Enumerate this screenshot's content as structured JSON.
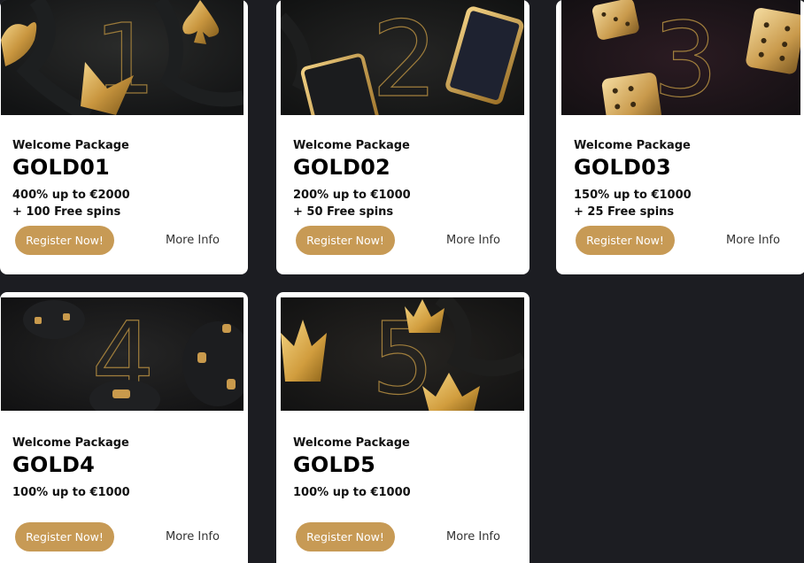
{
  "colors": {
    "page_bg": "#1c1d22",
    "card_bg": "#ffffff",
    "accent_gold": "#c79a55",
    "banner_bg": "#16171b"
  },
  "cards": [
    {
      "label": "Welcome Package",
      "code": "GOLD01",
      "bonus_line_1": "400% up to €2000",
      "bonus_line_2": "+ 100 Free spins",
      "register_label": "Register Now!",
      "more_info_label": "More Info",
      "banner_numeral": "1",
      "banner_icon": "gold-card-suits-icon"
    },
    {
      "label": "Welcome Package",
      "code": "GOLD02",
      "bonus_line_1": "200% up to €1000",
      "bonus_line_2": "+ 50 Free spins",
      "register_label": "Register Now!",
      "more_info_label": "More Info",
      "banner_numeral": "2",
      "banner_icon": "playing-cards-icon"
    },
    {
      "label": "Welcome Package",
      "code": "GOLD03",
      "bonus_line_1": "150% up to €1000",
      "bonus_line_2": "+ 25 Free spins",
      "register_label": "Register Now!",
      "more_info_label": "More Info",
      "banner_numeral": "3",
      "banner_icon": "gold-dice-icon"
    },
    {
      "label": "Welcome Package",
      "code": "GOLD4",
      "bonus_line_1": "100% up to €1000",
      "bonus_line_2": "",
      "register_label": "Register Now!",
      "more_info_label": "More Info",
      "banner_numeral": "4",
      "banner_icon": "casino-chips-icon"
    },
    {
      "label": "Welcome Package",
      "code": "GOLD5",
      "bonus_line_1": "100% up to €1000",
      "bonus_line_2": "",
      "register_label": "Register Now!",
      "more_info_label": "More Info",
      "banner_numeral": "5",
      "banner_icon": "gold-crowns-icon"
    }
  ]
}
